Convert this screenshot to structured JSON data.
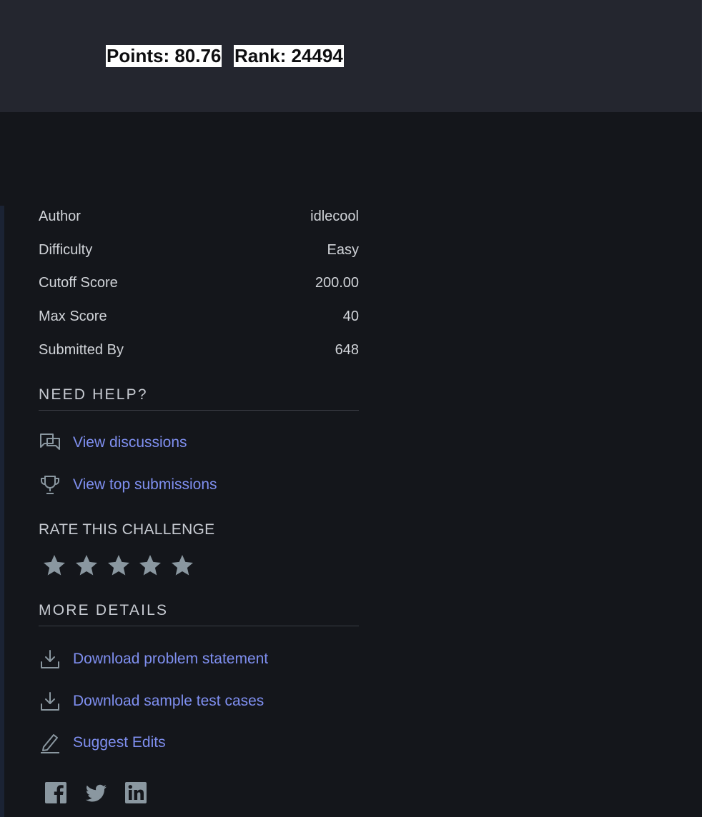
{
  "header": {
    "points_label": "Points: 80.76",
    "rank_label": "Rank: 24494"
  },
  "details": [
    {
      "key": "Author",
      "value": "idlecool",
      "style": "link"
    },
    {
      "key": "Difficulty",
      "value": "Easy",
      "style": "easy"
    },
    {
      "key": "Cutoff Score",
      "value": "200.00",
      "style": "plain"
    },
    {
      "key": "Max Score",
      "value": "40",
      "style": "plain"
    },
    {
      "key": "Submitted By",
      "value": "648",
      "style": "link"
    }
  ],
  "help": {
    "title": "NEED HELP?",
    "discussions_label": "View discussions",
    "top_submissions_label": "View top submissions"
  },
  "rate": {
    "title": "RATE THIS CHALLENGE",
    "stars_total": 5,
    "stars_filled": 0
  },
  "more": {
    "title": "MORE DETAILS",
    "download_statement_label": "Download problem statement",
    "download_tests_label": "Download sample test cases",
    "suggest_edits_label": "Suggest Edits"
  },
  "social": [
    "facebook-icon",
    "twitter-icon",
    "linkedin-icon"
  ],
  "colors": {
    "link": "#7f8ff0",
    "easy": "#4fb36a",
    "icon": "#8a97a0",
    "background": "#14161b",
    "header": "#24262f"
  }
}
